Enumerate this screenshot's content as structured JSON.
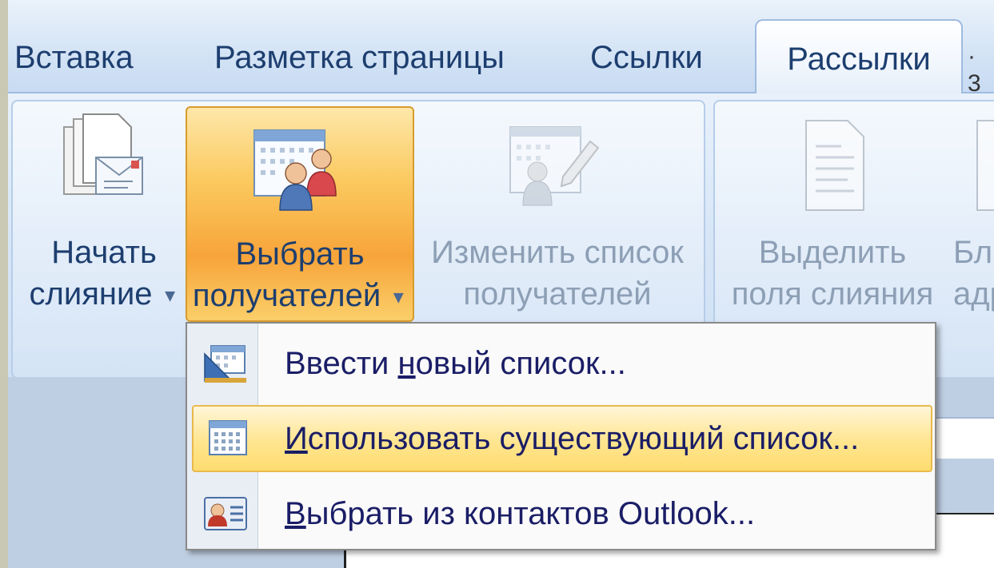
{
  "tabs": [
    {
      "label": "Вставка"
    },
    {
      "label": "Разметка страницы"
    },
    {
      "label": "Ссылки"
    },
    {
      "label": "Рассылки",
      "active": true
    }
  ],
  "ribbon": {
    "start_merge": {
      "line1": "Начать",
      "line2": "слияние"
    },
    "select_recipients": {
      "line1": "Выбрать",
      "line2": "получателей"
    },
    "edit_recipients": {
      "line1": "Изменить список",
      "line2": "получателей",
      "disabled": true
    },
    "highlight_fields": {
      "line1": "Выделить",
      "line2": "поля слияния",
      "disabled": true
    },
    "address_block": {
      "line1": "Бл",
      "line2": "адр",
      "disabled": true
    }
  },
  "menu": {
    "items": [
      {
        "pre": "Ввести ",
        "hotkey": "н",
        "post": "овый список...",
        "icon": "new-list-icon"
      },
      {
        "pre": "",
        "hotkey": "И",
        "post": "спользовать существующий список...",
        "icon": "existing-list-icon",
        "highlighted": true
      },
      {
        "pre": "",
        "hotkey": "В",
        "post": "ыбрать из контактов Outlook...",
        "icon": "outlook-contacts-icon"
      }
    ]
  },
  "ruler": {
    "number": "· 3"
  },
  "colors": {
    "accent_orange": "#f7a43a",
    "menu_highlight": "#ffe58f",
    "text_blue": "#1d3e6f"
  }
}
